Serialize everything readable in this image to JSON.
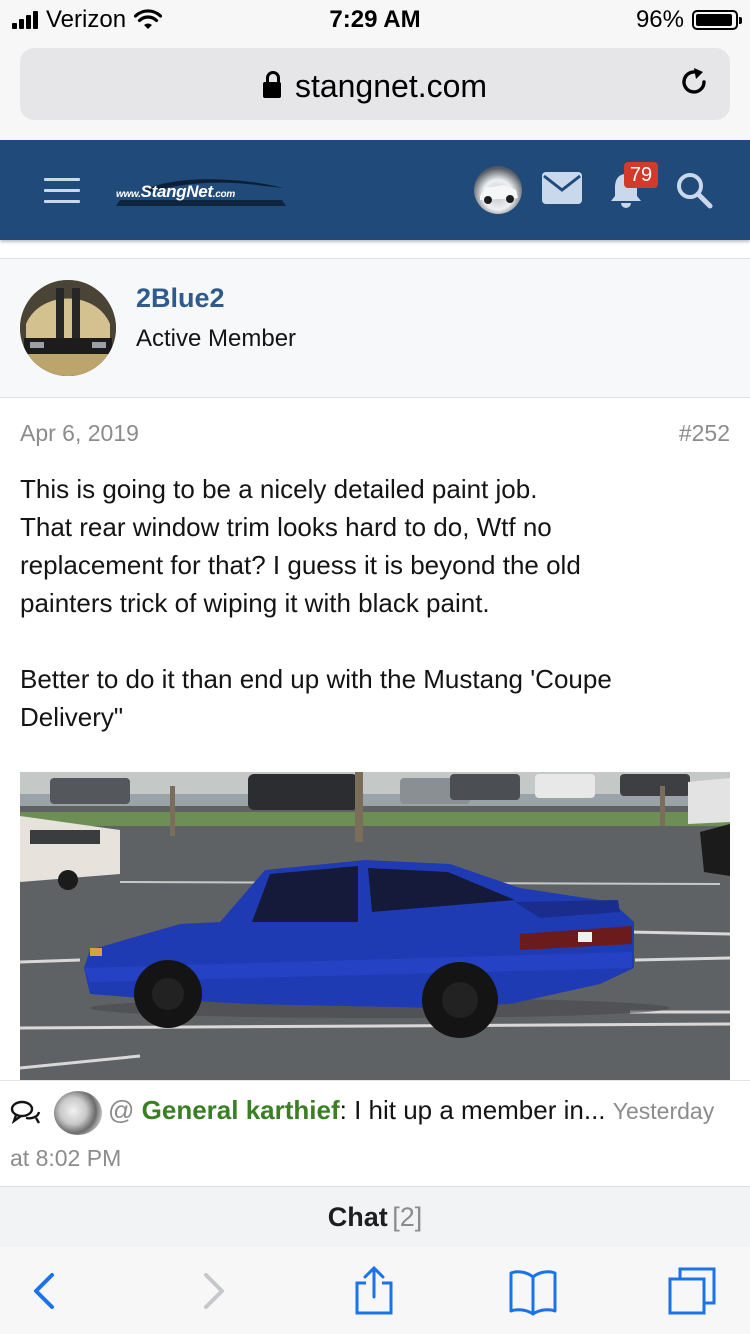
{
  "status_bar": {
    "carrier": "Verizon",
    "time": "7:29 AM",
    "battery": "96%",
    "battery_level": 0.96
  },
  "browser": {
    "url": "stangnet.com",
    "icons": [
      "lock-icon",
      "reload-icon"
    ]
  },
  "site_header": {
    "logo_prefix": "www.",
    "logo_name": "StangNet",
    "logo_suffix": ".com",
    "notification_count": "79",
    "icons": [
      "menu-icon",
      "user-avatar",
      "mail-icon",
      "bell-icon",
      "search-icon"
    ],
    "header_color": "#1f4a7a"
  },
  "member": {
    "username": "2Blue2",
    "title": "Active Member",
    "username_color": "#2f5b8c"
  },
  "post": {
    "date": "Apr 6, 2019",
    "number": "#252",
    "line1": "This is going to be a nicely detailed paint job.",
    "line2": "That rear window trim looks hard to do, Wtf no",
    "line3": "replacement for that? I guess it is beyond the old",
    "line4": "painters trick of wiping it with black paint.",
    "line5": "Better to do it than end up with the Mustang 'Coupe",
    "line6": "Delivery\""
  },
  "chat_notification": {
    "at": "@",
    "user": "General karthief",
    "message": ": I hit up a member in...",
    "time_part1": "Yesterday",
    "time_part2": "at 8:02 PM",
    "user_color": "#3a7f24"
  },
  "chat_bar": {
    "label": "Chat",
    "count": "[2]"
  },
  "toolbar": {
    "icons": [
      "back-icon",
      "forward-icon",
      "share-icon",
      "bookmarks-icon",
      "tabs-icon"
    ],
    "accent": "#1a73e8"
  }
}
